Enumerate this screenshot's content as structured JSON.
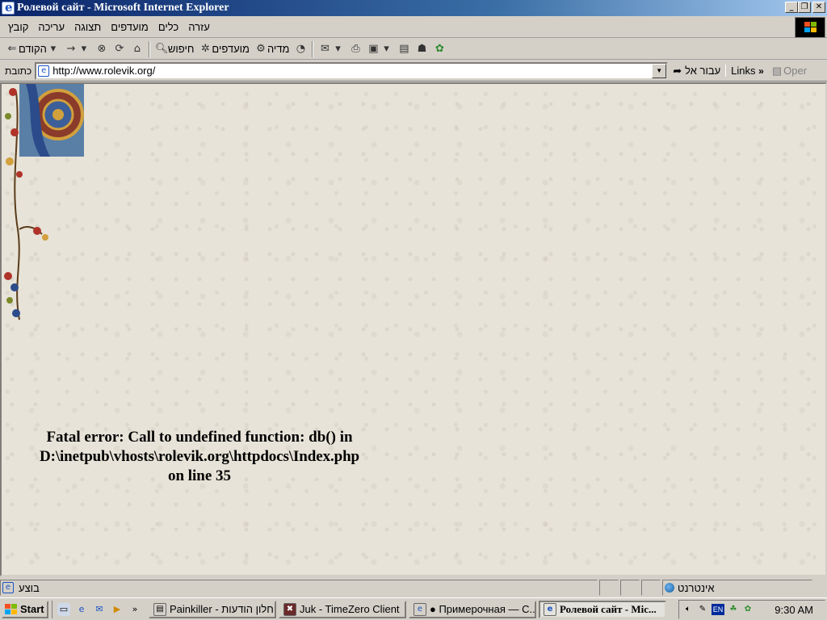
{
  "window": {
    "title": "Ролевой сайт - Microsoft Internet Explorer",
    "buttons": {
      "minimize": "_",
      "restore": "❐",
      "close": "✕"
    }
  },
  "menubar": {
    "items": [
      "קובץ",
      "עריכה",
      "תצוגה",
      "מועדפים",
      "כלים",
      "עזרה"
    ]
  },
  "toolbar": {
    "back_label": "הקודם",
    "search_label": "חיפוש",
    "favorites_label": "מועדפים",
    "media_label": "מדיה"
  },
  "addressbar": {
    "label": "כתובת",
    "url": "http://www.rolevik.org/",
    "go_label": "עבור אל",
    "links_label": "Links",
    "opera_label": "Oper"
  },
  "content": {
    "error_lines": [
      "Fatal error: Call to undefined function: db() in",
      "D:\\inetpub\\vhosts\\rolevik.org\\httpdocs\\Index.php",
      "on line 35"
    ]
  },
  "statusbar": {
    "status_text": "בוצע",
    "zone_text": "אינטרנט"
  },
  "taskbar": {
    "start_label": "Start",
    "tasks": [
      {
        "label": "Painkiller - חלון הודעות",
        "active": false
      },
      {
        "label": "Juk - TimeZero Client",
        "active": false
      },
      {
        "label": "● Примерочная — С...",
        "active": false
      },
      {
        "label": "Ролевой сайт - Mic...",
        "active": true
      }
    ],
    "language": "EN",
    "clock": "9:30 AM"
  },
  "colors": {
    "titlebar_start": "#0a246a",
    "titlebar_end": "#a6caf0",
    "page_background": "#e7e3d8",
    "chrome": "#d4d0c8"
  }
}
